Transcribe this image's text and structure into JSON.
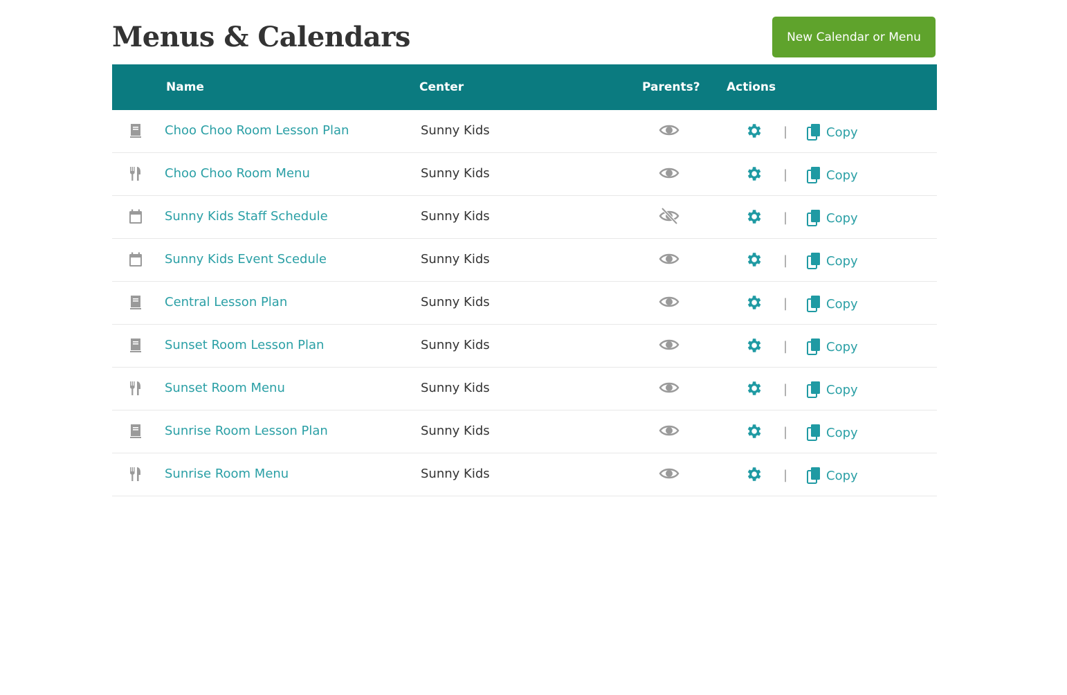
{
  "page": {
    "title": "Menus & Calendars"
  },
  "toolbar": {
    "new_button_label": "New Calendar or Menu"
  },
  "table": {
    "headers": {
      "name": "Name",
      "center": "Center",
      "parents": "Parents?",
      "actions": "Actions"
    },
    "separator": "|",
    "rows": [
      {
        "type_icon": "lesson-plan-icon",
        "name": "Choo Choo Room Lesson Plan",
        "center": "Sunny Kids",
        "parents_visible": true,
        "copy_label": "Copy"
      },
      {
        "type_icon": "menu-icon",
        "name": "Choo Choo Room Menu",
        "center": "Sunny Kids",
        "parents_visible": true,
        "copy_label": "Copy"
      },
      {
        "type_icon": "calendar-icon",
        "name": "Sunny Kids Staff Schedule",
        "center": "Sunny Kids",
        "parents_visible": false,
        "copy_label": "Copy"
      },
      {
        "type_icon": "calendar-icon",
        "name": "Sunny Kids Event Scedule",
        "center": "Sunny Kids",
        "parents_visible": true,
        "copy_label": "Copy"
      },
      {
        "type_icon": "lesson-plan-icon",
        "name": "Central Lesson Plan",
        "center": "Sunny Kids",
        "parents_visible": true,
        "copy_label": "Copy"
      },
      {
        "type_icon": "lesson-plan-icon",
        "name": "Sunset Room Lesson Plan",
        "center": "Sunny Kids",
        "parents_visible": true,
        "copy_label": "Copy"
      },
      {
        "type_icon": "menu-icon",
        "name": "Sunset Room Menu",
        "center": "Sunny Kids",
        "parents_visible": true,
        "copy_label": "Copy"
      },
      {
        "type_icon": "lesson-plan-icon",
        "name": "Sunrise Room Lesson Plan",
        "center": "Sunny Kids",
        "parents_visible": true,
        "copy_label": "Copy"
      },
      {
        "type_icon": "menu-icon",
        "name": "Sunrise Room Menu",
        "center": "Sunny Kids",
        "parents_visible": true,
        "copy_label": "Copy"
      }
    ]
  },
  "colors": {
    "header_bg": "#0b7b80",
    "button_bg": "#5fa32c",
    "link": "#2a9fa5",
    "icon_grey": "#9a9a9a"
  }
}
